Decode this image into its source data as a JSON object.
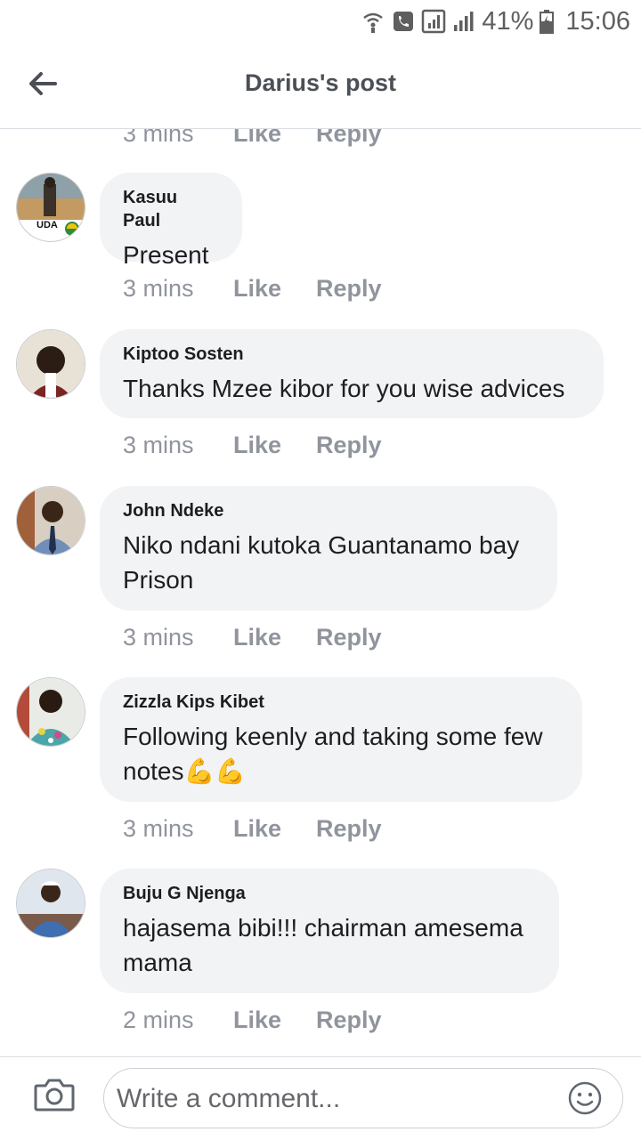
{
  "status_bar": {
    "battery": "41%",
    "time": "15:06"
  },
  "header": {
    "title": "Darius's post"
  },
  "comments": [
    {
      "time": "3 mins",
      "like": "Like",
      "reply": "Reply"
    },
    {
      "author": "Kasuu Paul",
      "text": "Present",
      "time": "3 mins",
      "like": "Like",
      "reply": "Reply",
      "avatar_badge": "UDA"
    },
    {
      "author": "Kiptoo Sosten",
      "text": "Thanks Mzee kibor for you wise advices",
      "time": "3 mins",
      "like": "Like",
      "reply": "Reply"
    },
    {
      "author": "John Ndeke",
      "text_line1": "Niko ndani kutoka Guantanamo bay",
      "text_line2": "Prison",
      "time": "3 mins",
      "like": "Like",
      "reply": "Reply"
    },
    {
      "author": "Zizzla Kips Kibet",
      "text_line1": "Following keenly and taking some few",
      "text_line2": "notes",
      "emoji": "💪💪",
      "time": "3 mins",
      "like": "Like",
      "reply": "Reply"
    },
    {
      "author": "Buju G Njenga",
      "text_line1": "hajasema bibi!!! chairman amesema",
      "text_line2": "mama",
      "time": "2 mins",
      "like": "Like",
      "reply": "Reply"
    }
  ],
  "composer": {
    "placeholder": "Write a comment..."
  },
  "colors": {
    "bubble": "#f2f3f5",
    "meta": "#90949c",
    "divider": "#dadde1"
  }
}
